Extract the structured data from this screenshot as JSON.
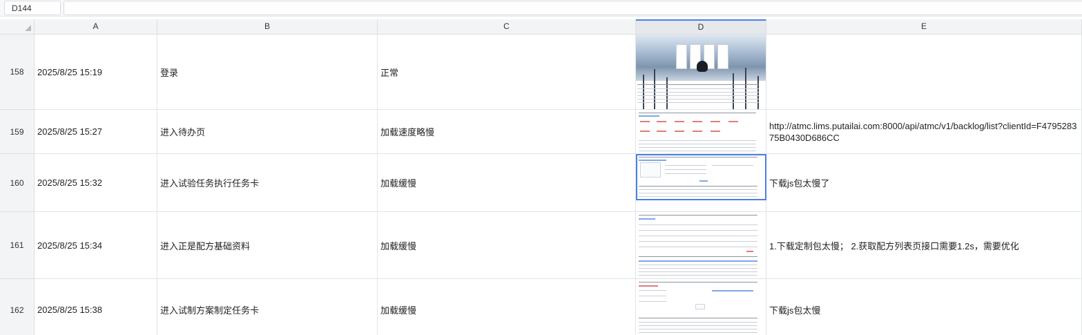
{
  "formula_bar": {
    "cell_ref": "D144",
    "content": ""
  },
  "columns": [
    {
      "id": "corner",
      "label": ""
    },
    {
      "id": "A",
      "label": "A"
    },
    {
      "id": "B",
      "label": "B"
    },
    {
      "id": "C",
      "label": "C"
    },
    {
      "id": "D",
      "label": "D"
    },
    {
      "id": "E",
      "label": "E"
    }
  ],
  "rows": [
    {
      "num": "158",
      "a": "2025/8/25 15:19",
      "b": "登录",
      "c": "正常",
      "e": ""
    },
    {
      "num": "159",
      "a": "2025/8/25 15:27",
      "b": "进入待办页",
      "c": "加载速度略慢",
      "e": "http://atmc.lims.putailai.com:8000/api/atmc/v1/backlog/list?clientId=F4795283 75B0430D686CC"
    },
    {
      "num": "160",
      "a": "2025/8/25 15:32",
      "b": "进入试验任务执行任务卡",
      "c": "加载缓慢",
      "e": "下载js包太慢了"
    },
    {
      "num": "161",
      "a": "2025/8/25 15:34",
      "b": "进入正是配方基础资料",
      "c": "加载缓慢",
      "e": "1.下载定制包太慢；  2.获取配方列表页接口需要1.2s，需要优化"
    },
    {
      "num": "162",
      "a": "2025/8/25 15:38",
      "b": "进入试制方案制定任务卡",
      "c": "加载缓慢",
      "e": "下载js包太慢"
    }
  ],
  "selected_column": "D",
  "colors": {
    "accent": "#4a7fe5",
    "header_bg": "#f3f4f6",
    "grid_line": "#e1e3e6"
  }
}
